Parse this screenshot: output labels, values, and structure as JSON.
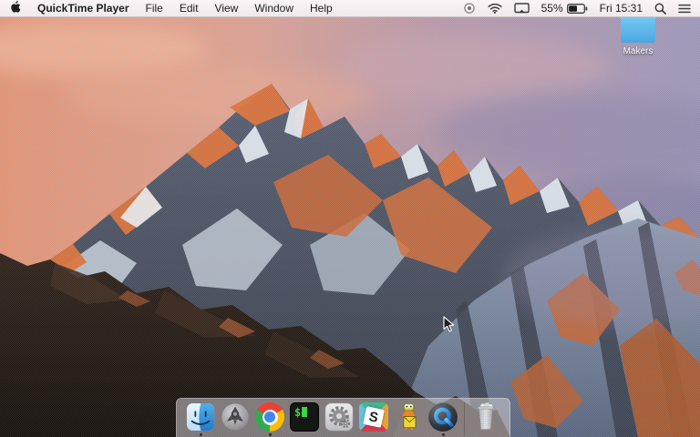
{
  "menu_bar": {
    "app_name": "QuickTime Player",
    "menus": [
      "File",
      "Edit",
      "View",
      "Window",
      "Help"
    ],
    "status": {
      "battery_percent": "55%",
      "clock": "Fri 15:31"
    },
    "status_icons": [
      "record-indicator",
      "wifi",
      "airplay-display",
      "battery",
      "spotlight",
      "notification-center"
    ]
  },
  "desktop": {
    "folder_label": "Makers"
  },
  "dock": {
    "items": [
      {
        "name": "finder",
        "running": true
      },
      {
        "name": "launchpad",
        "running": false
      },
      {
        "name": "chrome",
        "running": true
      },
      {
        "name": "terminal",
        "running": false,
        "glyph": "$"
      },
      {
        "name": "system-preferences",
        "running": false
      },
      {
        "name": "slack",
        "running": false,
        "glyph": "S"
      },
      {
        "name": "duck-app",
        "running": false
      },
      {
        "name": "quicktime-player",
        "running": true
      },
      {
        "name": "trash",
        "running": false
      }
    ]
  },
  "colors": {
    "menubar_bg": "#f6f0f2",
    "dock_bg": "rgba(208,202,207,0.55)",
    "folder_blue": "#59b5ea",
    "sunlit_orange": "#d96f38",
    "sky_pink": "#dd9677",
    "sky_purple": "#9a93b3"
  }
}
